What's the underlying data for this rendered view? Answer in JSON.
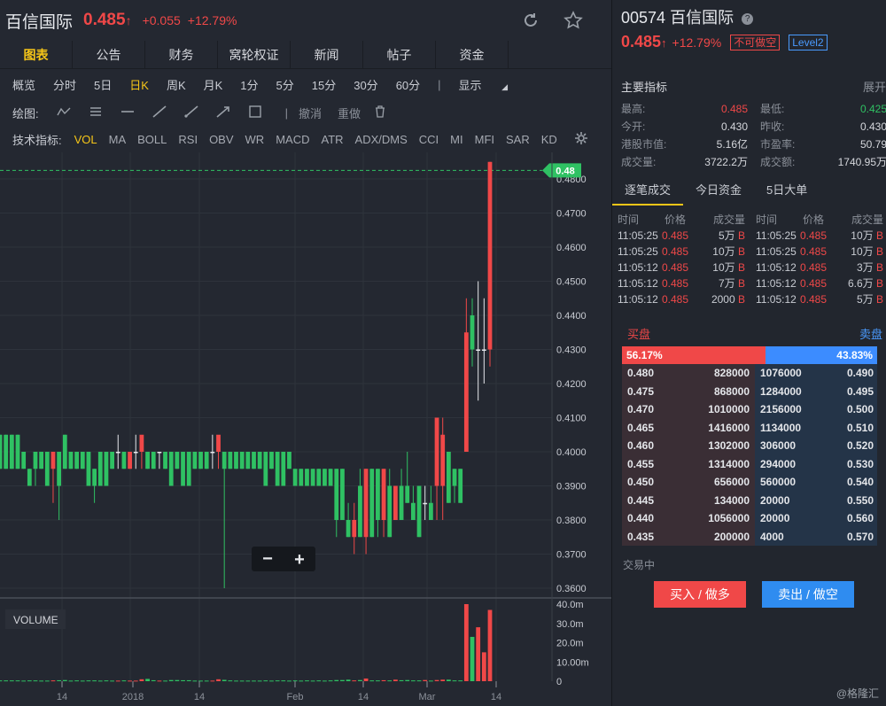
{
  "header": {
    "name": "百信国际",
    "price": "0.485",
    "change": "+0.055",
    "change_pct": "+12.79%",
    "refresh_icon": "refresh-icon",
    "star_icon": "star-icon"
  },
  "tabs": [
    "图表",
    "公告",
    "财务",
    "窝轮权证",
    "新闻",
    "帖子",
    "资金"
  ],
  "periods": [
    "概览",
    "分时",
    "5日",
    "日K",
    "周K",
    "月K",
    "1分",
    "5分",
    "15分",
    "30分",
    "60分"
  ],
  "display_label": "显示",
  "draw": {
    "label": "绘图:",
    "tools": [
      "polyline-icon",
      "parallel-lines-icon",
      "horizontal-line-icon",
      "line-icon",
      "ray-icon",
      "arrow-line-icon",
      "rectangle-icon"
    ],
    "undo": "撤消",
    "redo": "重做",
    "trash_icon": "trash-icon"
  },
  "indicators": {
    "label": "技术指标:",
    "items": [
      "VOL",
      "MA",
      "BOLL",
      "RSI",
      "OBV",
      "WR",
      "MACD",
      "ATR",
      "ADX/DMS",
      "CCI",
      "MI",
      "MFI",
      "SAR",
      "KD"
    ],
    "settings_icon": "gear-icon"
  },
  "chart_data": {
    "type": "candlestick",
    "y_ticks": [
      "0.4800",
      "0.4700",
      "0.4600",
      "0.4500",
      "0.4400",
      "0.4300",
      "0.4200",
      "0.4100",
      "0.4000",
      "0.3900",
      "0.3800",
      "0.3700",
      "0.3600"
    ],
    "ylim": [
      0.357,
      0.488
    ],
    "last_price_label": "0.48",
    "x_ticks": [
      "14",
      "2018",
      "14",
      "Feb",
      "14",
      "Mar",
      "14"
    ],
    "volume_label": "VOLUME",
    "volume_ticks": [
      "40.0m",
      "30.0m",
      "20.0m",
      "10.00m",
      "0"
    ],
    "volume_ylim": [
      0,
      40
    ],
    "zoom_out": "−",
    "zoom_in": "+",
    "candles": [
      [
        0.405,
        0.405,
        0.395,
        0.395,
        0.4
      ],
      [
        0.405,
        0.405,
        0.395,
        0.395,
        0.4
      ],
      [
        0.405,
        0.405,
        0.395,
        0.395,
        0.4
      ],
      [
        0.405,
        0.405,
        0.395,
        0.395,
        0.4
      ],
      [
        0.4,
        0.4,
        0.395,
        0.395,
        0.3
      ],
      [
        0.395,
        0.395,
        0.39,
        0.39,
        0.4
      ],
      [
        0.4,
        0.4,
        0.39,
        0.395,
        0.4
      ],
      [
        0.4,
        0.4,
        0.395,
        0.395,
        0.3
      ],
      [
        0.4,
        0.4,
        0.39,
        0.39,
        0.3
      ],
      [
        0.395,
        0.4,
        0.385,
        0.4,
        0.4
      ],
      [
        0.4,
        0.4,
        0.38,
        0.39,
        0.5
      ],
      [
        0.405,
        0.405,
        0.395,
        0.395,
        0.6
      ],
      [
        0.4,
        0.4,
        0.395,
        0.395,
        0.3
      ],
      [
        0.4,
        0.4,
        0.395,
        0.395,
        0.4
      ],
      [
        0.4,
        0.4,
        0.395,
        0.395,
        0.3
      ],
      [
        0.4,
        0.4,
        0.39,
        0.39,
        0.4
      ],
      [
        0.395,
        0.395,
        0.385,
        0.39,
        0.4
      ],
      [
        0.4,
        0.4,
        0.39,
        0.39,
        0.3
      ],
      [
        0.4,
        0.4,
        0.39,
        0.39,
        0.4
      ],
      [
        0.4,
        0.4,
        0.395,
        0.395,
        0.3
      ],
      [
        0.4,
        0.405,
        0.395,
        0.4,
        0.3
      ],
      [
        0.4,
        0.4,
        0.395,
        0.395,
        0.4
      ],
      [
        0.395,
        0.4,
        0.395,
        0.4,
        0.3
      ],
      [
        0.4,
        0.405,
        0.395,
        0.4,
        0.3
      ],
      [
        0.4,
        0.4,
        0.395,
        0.405,
        1.0
      ],
      [
        0.4,
        0.4,
        0.395,
        0.395,
        1.2
      ],
      [
        0.4,
        0.4,
        0.395,
        0.395,
        0.5
      ],
      [
        0.4,
        0.4,
        0.395,
        0.4,
        0.3
      ],
      [
        0.4,
        0.4,
        0.395,
        0.395,
        0.3
      ],
      [
        0.4,
        0.4,
        0.39,
        0.39,
        0.6
      ],
      [
        0.4,
        0.4,
        0.395,
        0.395,
        0.6
      ],
      [
        0.4,
        0.4,
        0.39,
        0.39,
        0.5
      ],
      [
        0.4,
        0.4,
        0.39,
        0.39,
        0.5
      ],
      [
        0.4,
        0.4,
        0.395,
        0.395,
        0.3
      ],
      [
        0.4,
        0.4,
        0.395,
        0.395,
        0.3
      ],
      [
        0.4,
        0.4,
        0.395,
        0.395,
        0.3
      ],
      [
        0.4,
        0.405,
        0.395,
        0.4,
        0.3
      ],
      [
        0.4,
        0.4,
        0.395,
        0.405,
        1.0
      ],
      [
        0.4,
        0.4,
        0.36,
        0.395,
        0.7
      ],
      [
        0.4,
        0.4,
        0.395,
        0.395,
        0.4
      ],
      [
        0.4,
        0.4,
        0.395,
        0.395,
        0.3
      ],
      [
        0.4,
        0.4,
        0.395,
        0.395,
        0.3
      ],
      [
        0.4,
        0.4,
        0.395,
        0.395,
        0.3
      ],
      [
        0.4,
        0.4,
        0.395,
        0.395,
        0.3
      ],
      [
        0.4,
        0.4,
        0.395,
        0.395,
        0.3
      ],
      [
        0.4,
        0.4,
        0.39,
        0.39,
        0.4
      ],
      [
        0.4,
        0.4,
        0.395,
        0.395,
        0.3
      ],
      [
        0.4,
        0.4,
        0.39,
        0.39,
        0.4
      ],
      [
        0.4,
        0.4,
        0.39,
        0.39,
        0.4
      ],
      [
        0.4,
        0.4,
        0.395,
        0.395,
        0.3
      ],
      [
        0.395,
        0.395,
        0.39,
        0.39,
        0.4
      ],
      [
        0.395,
        0.395,
        0.39,
        0.39,
        0.3
      ],
      [
        0.395,
        0.395,
        0.39,
        0.39,
        0.4
      ],
      [
        0.395,
        0.395,
        0.39,
        0.39,
        0.3
      ],
      [
        0.395,
        0.395,
        0.39,
        0.39,
        0.4
      ],
      [
        0.395,
        0.395,
        0.39,
        0.39,
        0.3
      ],
      [
        0.395,
        0.395,
        0.39,
        0.39,
        0.4
      ],
      [
        0.395,
        0.395,
        0.375,
        0.38,
        0.6
      ],
      [
        0.395,
        0.395,
        0.38,
        0.38,
        0.6
      ],
      [
        0.38,
        0.385,
        0.375,
        0.375,
        0.8
      ],
      [
        0.375,
        0.385,
        0.37,
        0.38,
        0.4
      ],
      [
        0.39,
        0.395,
        0.375,
        0.375,
        0.6
      ],
      [
        0.375,
        0.395,
        0.37,
        0.395,
        1.4
      ],
      [
        0.395,
        0.395,
        0.375,
        0.375,
        0.4
      ],
      [
        0.395,
        0.395,
        0.375,
        0.38,
        0.4
      ],
      [
        0.38,
        0.395,
        0.375,
        0.395,
        0.5
      ],
      [
        0.39,
        0.395,
        0.375,
        0.375,
        0.4
      ],
      [
        0.38,
        0.39,
        0.38,
        0.39,
        0.8
      ],
      [
        0.39,
        0.395,
        0.38,
        0.38,
        0.5
      ],
      [
        0.39,
        0.4,
        0.385,
        0.385,
        0.6
      ],
      [
        0.385,
        0.39,
        0.38,
        0.38,
        0.4
      ],
      [
        0.39,
        0.39,
        0.375,
        0.375,
        0.4
      ],
      [
        0.385,
        0.39,
        0.38,
        0.385,
        0.6
      ],
      [
        0.385,
        0.39,
        0.38,
        0.38,
        0.3
      ],
      [
        0.39,
        0.405,
        0.38,
        0.41,
        0.6
      ],
      [
        0.39,
        0.41,
        0.38,
        0.405,
        0.8
      ],
      [
        0.4,
        0.4,
        0.385,
        0.385,
        0.8
      ],
      [
        0.395,
        0.395,
        0.385,
        0.39,
        0.4
      ],
      [
        0.395,
        0.395,
        0.385,
        0.385,
        0.4
      ],
      [
        0.4,
        0.445,
        0.4,
        0.435,
        40.0
      ],
      [
        0.44,
        0.445,
        0.425,
        0.43,
        23.0
      ],
      [
        0.43,
        0.45,
        0.415,
        0.43,
        28.0
      ],
      [
        0.43,
        0.445,
        0.42,
        0.43,
        15.0
      ],
      [
        0.43,
        0.485,
        0.425,
        0.485,
        37.0
      ]
    ]
  },
  "quote": {
    "code": "00574",
    "name": "百信国际",
    "help_icon": "help-icon",
    "price": "0.485",
    "pct": "+12.79%",
    "badge_short": "不可做空",
    "badge_level": "Level2"
  },
  "metrics": {
    "title": "主要指标",
    "expand": "展开",
    "rows": [
      {
        "k": "最高:",
        "v": "0.485",
        "k2": "最低:",
        "v2": "0.425"
      },
      {
        "k": "今开:",
        "v": "0.430",
        "k2": "昨收:",
        "v2": "0.430"
      },
      {
        "k": "港股市值:",
        "v": "5.16亿",
        "k2": "市盈率:",
        "v2": "50.79"
      },
      {
        "k": "成交量:",
        "v": "3722.2万",
        "k2": "成交额:",
        "v2": "1740.95万"
      }
    ]
  },
  "trade_tabs": [
    "逐笔成交",
    "今日资金",
    "5日大单"
  ],
  "ticks": {
    "headers": [
      "时间",
      "价格",
      "成交量"
    ],
    "left": [
      {
        "t": "11:05:25",
        "p": "0.485",
        "q": "5万",
        "d": "B"
      },
      {
        "t": "11:05:25",
        "p": "0.485",
        "q": "10万",
        "d": "B"
      },
      {
        "t": "11:05:12",
        "p": "0.485",
        "q": "10万",
        "d": "B"
      },
      {
        "t": "11:05:12",
        "p": "0.485",
        "q": "7万",
        "d": "B"
      },
      {
        "t": "11:05:12",
        "p": "0.485",
        "q": "2000",
        "d": "B"
      }
    ],
    "right": [
      {
        "t": "11:05:25",
        "p": "0.485",
        "q": "10万",
        "d": "B"
      },
      {
        "t": "11:05:25",
        "p": "0.485",
        "q": "10万",
        "d": "B"
      },
      {
        "t": "11:05:12",
        "p": "0.485",
        "q": "3万",
        "d": "B"
      },
      {
        "t": "11:05:12",
        "p": "0.485",
        "q": "6.6万",
        "d": "B"
      },
      {
        "t": "11:05:12",
        "p": "0.485",
        "q": "5万",
        "d": "B"
      }
    ]
  },
  "book": {
    "buy_label": "买盘",
    "sell_label": "卖盘",
    "buy_pct": "56.17%",
    "sell_pct": "43.83%",
    "buy_ratio": 0.5617,
    "rows": [
      {
        "bp": "0.480",
        "bq": "828000",
        "aq": "1076000",
        "ap": "0.490"
      },
      {
        "bp": "0.475",
        "bq": "868000",
        "aq": "1284000",
        "ap": "0.495"
      },
      {
        "bp": "0.470",
        "bq": "1010000",
        "aq": "2156000",
        "ap": "0.500"
      },
      {
        "bp": "0.465",
        "bq": "1416000",
        "aq": "1134000",
        "ap": "0.510"
      },
      {
        "bp": "0.460",
        "bq": "1302000",
        "aq": "306000",
        "ap": "0.520"
      },
      {
        "bp": "0.455",
        "bq": "1314000",
        "aq": "294000",
        "ap": "0.530"
      },
      {
        "bp": "0.450",
        "bq": "656000",
        "aq": "560000",
        "ap": "0.540"
      },
      {
        "bp": "0.445",
        "bq": "134000",
        "aq": "20000",
        "ap": "0.550"
      },
      {
        "bp": "0.440",
        "bq": "1056000",
        "aq": "20000",
        "ap": "0.560"
      },
      {
        "bp": "0.435",
        "bq": "200000",
        "aq": "4000",
        "ap": "0.570"
      }
    ]
  },
  "status": "交易中",
  "buy_button": "买入 / 做多",
  "sell_button": "卖出 / 做空",
  "watermark": "@格隆汇",
  "colors": {
    "up": "#f04848",
    "down": "#2fc163",
    "accent": "#f5c518",
    "sell": "#2f8cf0"
  }
}
